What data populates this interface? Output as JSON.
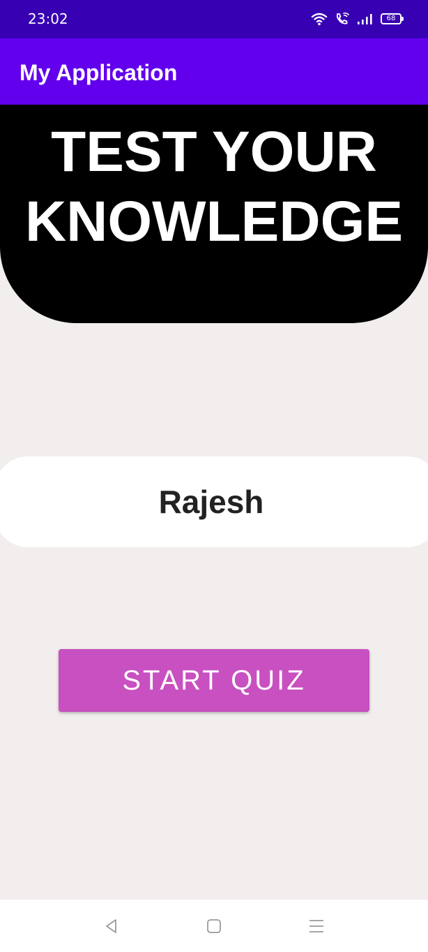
{
  "status_bar": {
    "time": "23:02",
    "battery_level": "68",
    "icons": [
      "wifi-icon",
      "wifi-calling-icon",
      "signal-icon",
      "battery-icon"
    ]
  },
  "app_bar": {
    "title": "My Application"
  },
  "hero": {
    "line1": "TEST YOUR",
    "line2": "KNOWLEDGE"
  },
  "name_card": {
    "value": "Rajesh"
  },
  "start_button": {
    "label": "START QUIZ"
  },
  "nav_bar": {
    "icons": [
      "back-icon",
      "home-icon",
      "recents-icon"
    ]
  },
  "colors": {
    "status_bar": "#3700b3",
    "app_bar": "#6200ee",
    "hero_bg": "#000000",
    "page_bg": "#f2eeee",
    "button": "#c850c0"
  }
}
